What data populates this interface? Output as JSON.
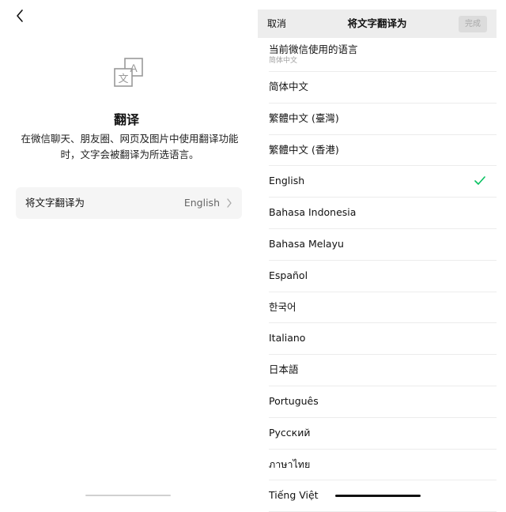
{
  "left": {
    "title": "翻译",
    "description": "在微信聊天、朋友圈、网页及图片中使用翻译功能时，文字会被翻译为所选语言。",
    "setting": {
      "label": "将文字翻译为",
      "value": "English"
    },
    "icons": {
      "back": "chevron-left-icon",
      "translate": "translate-icon",
      "chevron": "chevron-right-icon"
    },
    "translate_icon_letters": [
      "文",
      "A"
    ]
  },
  "right": {
    "nav": {
      "cancel_label": "取消",
      "title": "将文字翻译为",
      "done_label": "完成"
    },
    "current_language": {
      "label": "当前微信使用的语言",
      "value": "简体中文"
    },
    "languages": [
      {
        "name": "简体中文",
        "selected": false
      },
      {
        "name": "繁體中文 (臺灣)",
        "selected": false
      },
      {
        "name": "繁體中文 (香港)",
        "selected": false
      },
      {
        "name": "English",
        "selected": true
      },
      {
        "name": "Bahasa Indonesia",
        "selected": false
      },
      {
        "name": "Bahasa Melayu",
        "selected": false
      },
      {
        "name": "Español",
        "selected": false
      },
      {
        "name": "한국어",
        "selected": false
      },
      {
        "name": "Italiano",
        "selected": false
      },
      {
        "name": "日本語",
        "selected": false
      },
      {
        "name": "Português",
        "selected": false
      },
      {
        "name": "Русский",
        "selected": false
      },
      {
        "name": "ภาษาไทย",
        "selected": false
      },
      {
        "name": "Tiếng Việt",
        "selected": false
      }
    ],
    "icons": {
      "check": "checkmark-icon"
    }
  },
  "colors": {
    "check": "#07c160",
    "nav_bg": "#ededed",
    "row_bg": "#f5f5f5"
  }
}
